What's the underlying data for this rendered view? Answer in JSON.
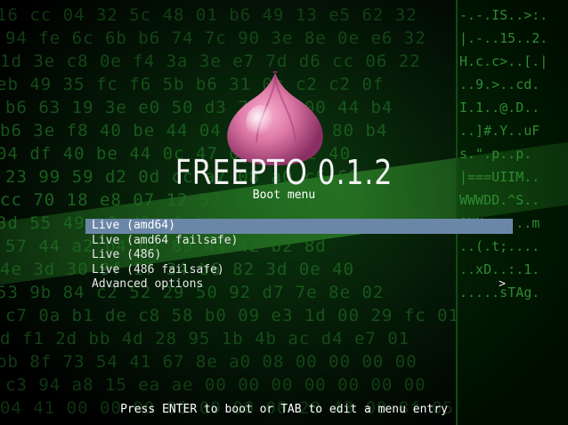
{
  "background": {
    "hex_lines": [
      "16 cc 04 32 5c 48 01 b6 49 13 e5 62 32",
      "94 fe 6c 6b b6 74 7c 90 3e 8e 0e e6 32",
      "1d 3e c8 0e f4 3a 3e e7 7d d6 cc 06 22",
      "eb 49 35 fc f6 5b b6 31 0c c2 c2 0f",
      "b6 63 19 3e e0 50 d3 75 46 00 44 b4",
      "b6 3e f8 40 be 44 04 cc 57 ad 80 b4",
      "04 df 40 be 44 0c 47 0d 3c 0c 40",
      "23 99 59 d2 0d cc a7 08 a0 c6 69",
      "cc 70 18 e8 07 12 52 0b 08 13",
      "3d 55 49 c0 d2 a6 39 6e a0",
      "57 44 a2 b4 b2 89 44 42 b2 8d",
      "4e 3d 30 9f 1f 34 b6 82 3d 0e 40",
      "53 9b 84 c2 52 29 50 92 d7 7e 8e 02",
      "c7 0a b1 de c8 58 b0 09 e3 1d 00 29 fc 01",
      "d f1 2d bb 4d 28 95 1b 4b ac d4 e7 01",
      "bb 8f 73 54 41 67 8e a0 08 00 00 00 00",
      "c3 94 a8 15 ea ae 00 00 00 00 00 00 00",
      "04 41 00 00 00 00 00 00 00 20 43 00 8f 05"
    ],
    "right_lines": [
      "-.-.IS..>:.",
      "|.-..15..2.",
      "H.c.c>..[.|",
      "..9.>..cd.",
      "I.1..@.D..",
      "..]#.Y..uF",
      "s.\".p..p.",
      "|===UIIM..",
      "WWWDD.^S..",
      "^NN===...m",
      "..(.t;....",
      "..xD..:.1.",
      ".....sTAg."
    ]
  },
  "branding": {
    "logo_icon": "onion-logo-icon",
    "title": "FREEPTO 0.1.2"
  },
  "menu": {
    "title": "Boot menu",
    "items": [
      {
        "label": "Live (amd64)",
        "selected": true
      },
      {
        "label": "Live (amd64 failsafe)",
        "selected": false
      },
      {
        "label": "Live (486)",
        "selected": false
      },
      {
        "label": "Live (486 failsafe)",
        "selected": false
      },
      {
        "label": "Advanced options",
        "selected": false,
        "submenu_arrow": ">"
      }
    ]
  },
  "footer": {
    "hint": "Press ENTER to boot or TAB to edit a menu entry"
  },
  "colors": {
    "selection": "#6b87a8",
    "text": "#e8e8e8",
    "matrix_green": "#1f6b22"
  }
}
